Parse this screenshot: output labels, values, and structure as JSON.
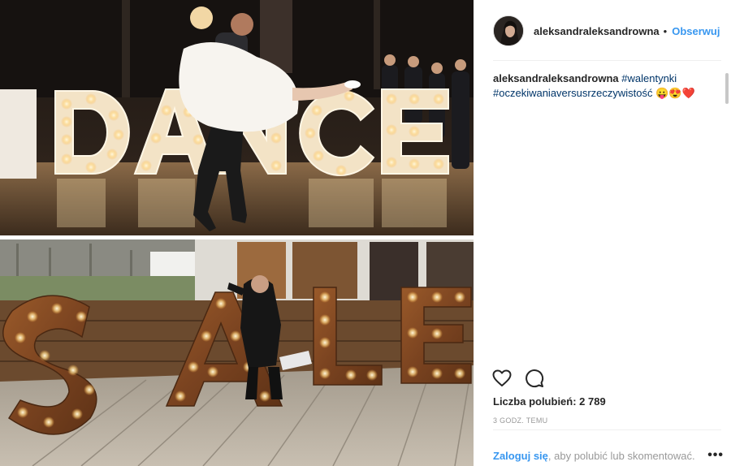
{
  "post": {
    "username": "aleksandraleksandrowna",
    "separator": "•",
    "follow_label": "Obserwuj",
    "caption": {
      "username": "aleksandraleksandrowna",
      "tag1": "#walentynki",
      "tag2": "#oczekiwaniaversusrzeczywistość",
      "emoji": "😛😍❤️"
    },
    "likes_text": "Liczba polubień: 2 789",
    "time_text": "3 GODZ. TEMU",
    "login_link": "Zaloguj się",
    "login_rest": ", aby polubić lub skomentować.",
    "more_label": "•••"
  },
  "photo": {
    "top_sign_letters": [
      "D",
      "A",
      "N",
      "C",
      "E"
    ],
    "bottom_sign_letters": [
      "S",
      "A",
      "L",
      "E"
    ]
  },
  "icons": {
    "like": "heart-icon",
    "comment": "comment-icon",
    "more": "more-options-icon"
  },
  "colors": {
    "accent": "#3897f0",
    "hashtag": "#003569",
    "muted": "#999999"
  }
}
